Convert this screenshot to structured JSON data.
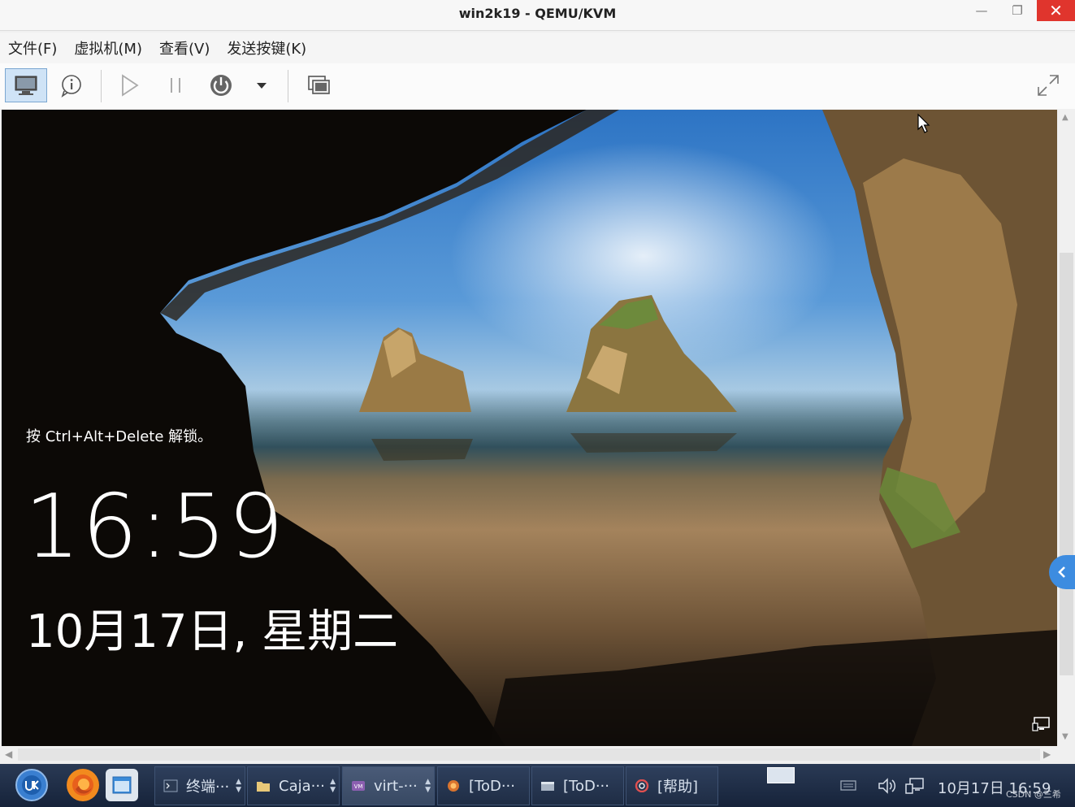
{
  "window": {
    "title": "win2k19 - QEMU/KVM",
    "minimize_glyph": "—",
    "maximize_glyph": "❐",
    "close_glyph": "✕"
  },
  "menu": [
    "文件(F)",
    "虚拟机(M)",
    "查看(V)",
    "发送按键(K)"
  ],
  "toolbar": {
    "icons": [
      "monitor-icon",
      "info-icon",
      "play-icon",
      "pause-icon",
      "power-icon",
      "dropdown-arrow-icon",
      "screenshot-icon",
      "fullscreen-icon"
    ]
  },
  "lockscreen": {
    "hint": "按 Ctrl+Alt+Delete 解锁。",
    "time": "16:59",
    "date": "10月17日, 星期二"
  },
  "taskbar": {
    "buttons": [
      {
        "label": "终端···",
        "icon": "terminal-icon"
      },
      {
        "label": "Caja···",
        "icon": "folder-icon"
      },
      {
        "label": "virt-···",
        "icon": "virt-manager-icon"
      },
      {
        "label": "[ToD···",
        "icon": "firefox-small-icon"
      },
      {
        "label": "[ToD···",
        "icon": "window-icon"
      },
      {
        "label": "[帮助]",
        "icon": "help-icon"
      }
    ],
    "clock": "10月17日 16:59",
    "watermark": "CSDN @三希"
  },
  "colors": {
    "close_button": "#e0352d",
    "taskbar": "#1b2a43",
    "side_tab": "#3d8ce0"
  }
}
